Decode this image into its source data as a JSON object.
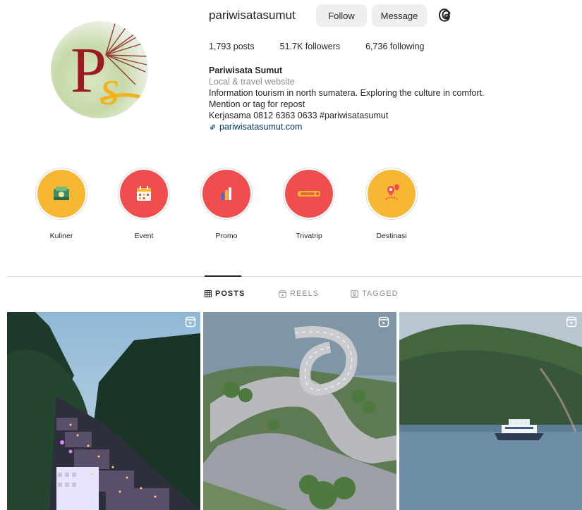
{
  "profile": {
    "username": "pariwisatasumut",
    "follow_label": "Follow",
    "message_label": "Message",
    "stats": {
      "posts": "1,793 posts",
      "followers": "51.7K followers",
      "following": "6,736 following"
    },
    "bio": {
      "name": "Pariwisata Sumut",
      "category": "Local & travel website",
      "line1": "Information tourism in north sumatera. Exploring the culture in comfort.",
      "line2": "Mention or tag for repost",
      "line3": "Kerjasama 0812 6363 0633 #pariwisatasumut",
      "link": "pariwisatasumut.com"
    }
  },
  "highlights": [
    {
      "label": "Kuliner",
      "color": "#f7b733",
      "icon": "food-icon"
    },
    {
      "label": "Event",
      "color": "#f04e4e",
      "icon": "calendar-icon"
    },
    {
      "label": "Promo",
      "color": "#f04e4e",
      "icon": "megaphone-icon"
    },
    {
      "label": "Trivatrip",
      "color": "#f04e4e",
      "icon": "ticket-icon"
    },
    {
      "label": "Destinasi",
      "color": "#f7b733",
      "icon": "map-pin-icon"
    }
  ],
  "tabs": {
    "posts": "POSTS",
    "reels": "REELS",
    "tagged": "TAGGED"
  },
  "colors": {
    "accent_red": "#f04e4e",
    "accent_yellow": "#f7b733",
    "link": "#00376b"
  }
}
